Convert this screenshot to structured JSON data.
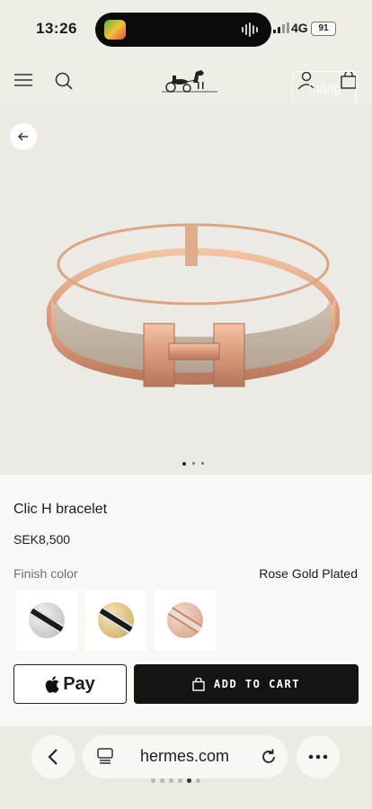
{
  "status_bar": {
    "time": "13:26",
    "network": "4G",
    "battery": "91"
  },
  "nav": {
    "close_label": "Stäng"
  },
  "hero": {
    "image_count": 3,
    "active_image": 1
  },
  "product": {
    "title": "Clic H bracelet",
    "price": "SEK8,500",
    "finish_label": "Finish color",
    "finish_value": "Rose Gold Plated",
    "swatches": [
      "palladium",
      "gold",
      "rose-gold"
    ]
  },
  "actions": {
    "apple_pay_label": "Pay",
    "add_to_cart_label": "ADD TO CART"
  },
  "browser": {
    "url": "hermes.com",
    "tab_count": 6,
    "active_tab": 4
  }
}
